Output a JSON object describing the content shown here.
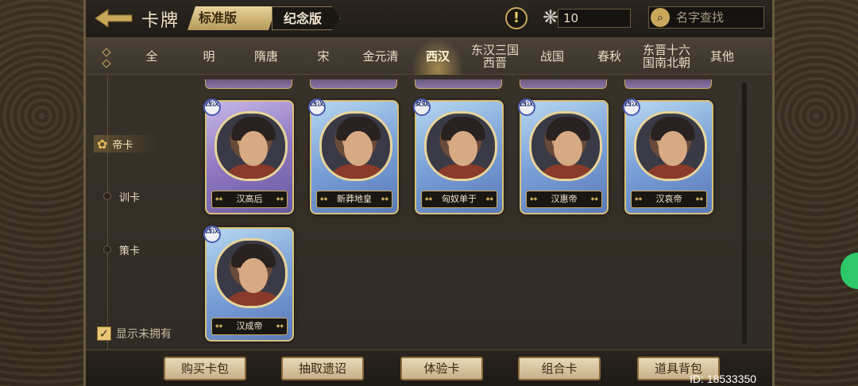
{
  "header": {
    "title": "卡牌",
    "edition_tabs": [
      "标准版",
      "纪念版"
    ],
    "currency_value": "10",
    "search_placeholder": "名字查找"
  },
  "era_tabs": [
    {
      "label": "全",
      "active": false
    },
    {
      "label": "明",
      "active": false
    },
    {
      "label": "隋唐",
      "active": false
    },
    {
      "label": "宋",
      "active": false
    },
    {
      "label": "金元清",
      "active": false
    },
    {
      "label": "西汉",
      "active": true
    },
    {
      "label": "东汉三国\n西晋",
      "active": false
    },
    {
      "label": "战国",
      "active": false
    },
    {
      "label": "春秋",
      "active": false
    },
    {
      "label": "东晋十六\n国南北朝",
      "active": false
    },
    {
      "label": "其他",
      "active": false
    }
  ],
  "categories": [
    {
      "label": "帝卡",
      "active": true
    },
    {
      "label": "训卡",
      "active": false
    },
    {
      "label": "策卡",
      "active": false
    }
  ],
  "show_unowned": {
    "label": "显示未拥有",
    "checked": true
  },
  "cards": [
    {
      "name": "汉高后",
      "badge": "西汉",
      "frame": "purple"
    },
    {
      "name": "新莽地皇",
      "badge": "西汉",
      "frame": "blue"
    },
    {
      "name": "匈奴单于",
      "badge": "安奴",
      "frame": "blue"
    },
    {
      "name": "汉惠帝",
      "badge": "西汉",
      "frame": "blue"
    },
    {
      "name": "汉哀帝",
      "badge": "西汉",
      "frame": "blue"
    },
    {
      "name": "汉成帝",
      "badge": "西汉",
      "frame": "blue"
    }
  ],
  "bottom_buttons": [
    "购买卡包",
    "抽取遗诏",
    "体验卡",
    "组合卡",
    "道具背包"
  ],
  "footer": {
    "id_text": "ID: 18533350"
  },
  "colors": {
    "gold": "#c9a85c",
    "panel": "#2f2a24",
    "active_glow": "#e6be64"
  }
}
